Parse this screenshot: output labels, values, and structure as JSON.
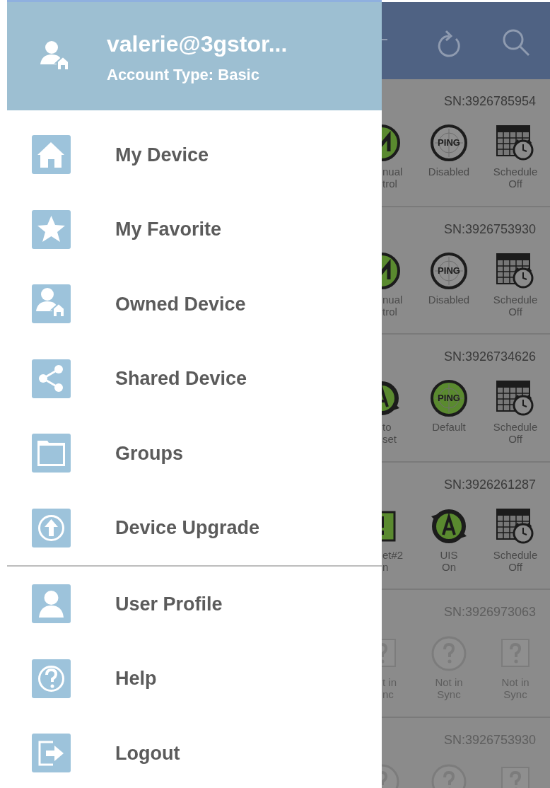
{
  "drawer": {
    "account": {
      "email": "valerie@3gstor...",
      "account_type": "Account Type: Basic"
    },
    "sections": [
      [
        {
          "kind": "home",
          "label": "My Device"
        },
        {
          "kind": "star",
          "label": "My Favorite"
        },
        {
          "kind": "owner",
          "label": "Owned Device"
        },
        {
          "kind": "share",
          "label": "Shared Device"
        },
        {
          "kind": "folder",
          "label": "Groups"
        },
        {
          "kind": "upgrade",
          "label": "Device Upgrade"
        }
      ],
      [
        {
          "kind": "user",
          "label": "User Profile"
        },
        {
          "kind": "help",
          "label": "Help"
        },
        {
          "kind": "logout",
          "label": "Logout"
        }
      ]
    ]
  },
  "devices": [
    {
      "serial": "SN:3926785954",
      "in_sync": true,
      "controls": [
        {
          "kind": "manual",
          "label": "nual\ntrol"
        },
        {
          "kind": "ping",
          "active": false,
          "icon_text": "PING",
          "label": "Disabled"
        },
        {
          "kind": "schedule",
          "label": "Schedule\nOff"
        }
      ]
    },
    {
      "serial": "SN:3926753930",
      "in_sync": true,
      "controls": [
        {
          "kind": "manual",
          "label": "nual\ntrol"
        },
        {
          "kind": "ping",
          "active": false,
          "icon_text": "PING",
          "label": "Disabled"
        },
        {
          "kind": "schedule",
          "label": "Schedule\nOff"
        }
      ]
    },
    {
      "serial": "SN:3926734626",
      "in_sync": true,
      "controls": [
        {
          "kind": "auto",
          "label": "to\nset"
        },
        {
          "kind": "ping",
          "active": true,
          "icon_text": "PING",
          "label": "Default"
        },
        {
          "kind": "schedule",
          "label": "Schedule\nOff"
        }
      ]
    },
    {
      "serial": "SN:3926261287",
      "in_sync": true,
      "controls": [
        {
          "kind": "outlet",
          "label": "et#2\nn"
        },
        {
          "kind": "auto",
          "label": "UIS\nOn"
        },
        {
          "kind": "schedule",
          "label": "Schedule\nOff"
        }
      ]
    },
    {
      "serial": "SN:3926973063",
      "in_sync": false,
      "controls": [
        {
          "kind": "unknown_square",
          "label": "t in\nnc"
        },
        {
          "kind": "unknown_circle",
          "label": "Not in\nSync"
        },
        {
          "kind": "unknown_square",
          "label": "Not in\nSync"
        }
      ]
    },
    {
      "serial": "SN:3926753930",
      "in_sync": false,
      "controls": [
        {
          "kind": "unknown_circle"
        },
        {
          "kind": "unknown_circle"
        },
        {
          "kind": "unknown_square"
        }
      ]
    }
  ]
}
